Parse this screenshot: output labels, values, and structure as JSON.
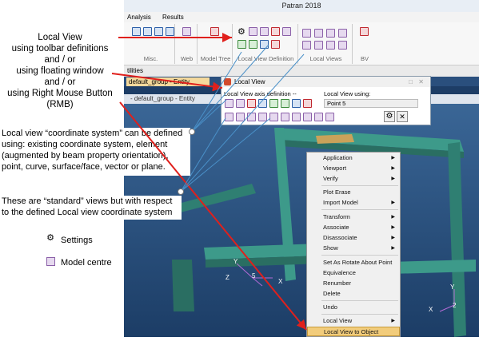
{
  "annotations": {
    "local_view": [
      "Local View",
      "using toolbar definitions",
      "and / or",
      "using floating window",
      "and / or",
      "using Right Mouse Button",
      "(RMB)"
    ],
    "coord_system": "Local view “coordinate system” can be defined using: existing coordinate system, element (augmented by beam property orientation), point, curve, surface/face, vector or plane.",
    "standard_views": "These are “standard” views but with respect to the defined Local view coordinate system",
    "settings": "Settings",
    "model_centre": "Model  centre"
  },
  "app": {
    "title": "Patran 2018",
    "menu": [
      "Analysis",
      "Results"
    ],
    "ribbon_groups": [
      "Misc.",
      "Web",
      "Model Tree",
      "Local View Definition",
      "Local Views",
      "BV"
    ],
    "tab_strip": "tilities",
    "active_tab": "default_group - Entity",
    "viewport_title": "- default_group - Entity"
  },
  "local_view_window": {
    "title": "Local View",
    "axis_label": "Local View axis definition --",
    "using_label": "Local View using:",
    "using_value": "Point 5"
  },
  "context_menu": {
    "items": [
      {
        "label": "Application",
        "sub": true
      },
      {
        "label": "Viewport",
        "sub": true
      },
      {
        "label": "Verify",
        "sub": true
      },
      {
        "label": "Plot Erase",
        "sub": false
      },
      {
        "label": "Import Model",
        "sub": true
      },
      {
        "label": "Transform",
        "sub": true
      },
      {
        "label": "Associate",
        "sub": true
      },
      {
        "label": "Disassociate",
        "sub": true
      },
      {
        "label": "Show",
        "sub": true
      },
      {
        "label": "Set As Rotate About Point",
        "sub": false
      },
      {
        "label": "Equivalence",
        "sub": false
      },
      {
        "label": "Renumber",
        "sub": false
      },
      {
        "label": "Delete",
        "sub": false
      },
      {
        "label": "Undo",
        "sub": false
      },
      {
        "label": "Local View",
        "sub": true
      },
      {
        "label": "Local View to Object",
        "sub": false
      }
    ]
  },
  "axes": {
    "left": {
      "y": "Y",
      "z": "Z",
      "x": "X",
      "n": "5"
    },
    "right": {
      "y": "Y",
      "x": "X",
      "n": "2"
    }
  },
  "colors": {
    "arrow": "#e0201c",
    "callout_line": "#4a90c8",
    "highlight": "#f2cc7b"
  }
}
